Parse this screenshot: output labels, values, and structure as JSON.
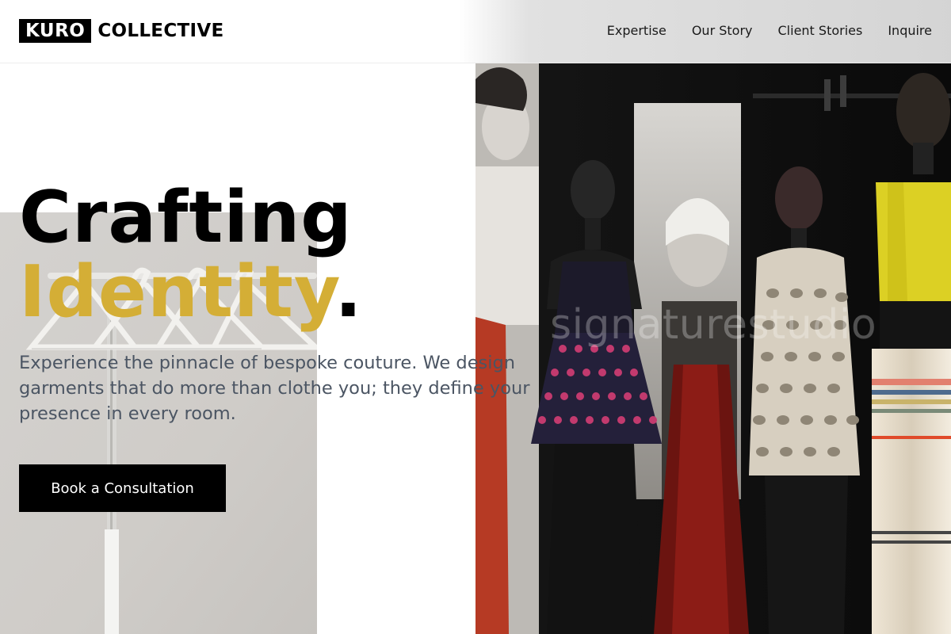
{
  "brand": {
    "logo_box": "KURO",
    "logo_word": "COLLECTIVE"
  },
  "nav": {
    "items": [
      {
        "label": "Expertise"
      },
      {
        "label": "Our Story"
      },
      {
        "label": "Client Stories"
      },
      {
        "label": "Inquire"
      }
    ]
  },
  "hero": {
    "headline_line1": "Crafting",
    "headline_line2": "Identity",
    "headline_dot": ".",
    "lede": "Experience the pinnacle of bespoke couture. We design garments that do more than clothe you; they define your presence in every room.",
    "cta_label": "Book a Consultation"
  },
  "watermark": "signaturestudio",
  "colors": {
    "accent": "#d4ae36",
    "text_muted": "#4b5563",
    "black": "#000000"
  }
}
